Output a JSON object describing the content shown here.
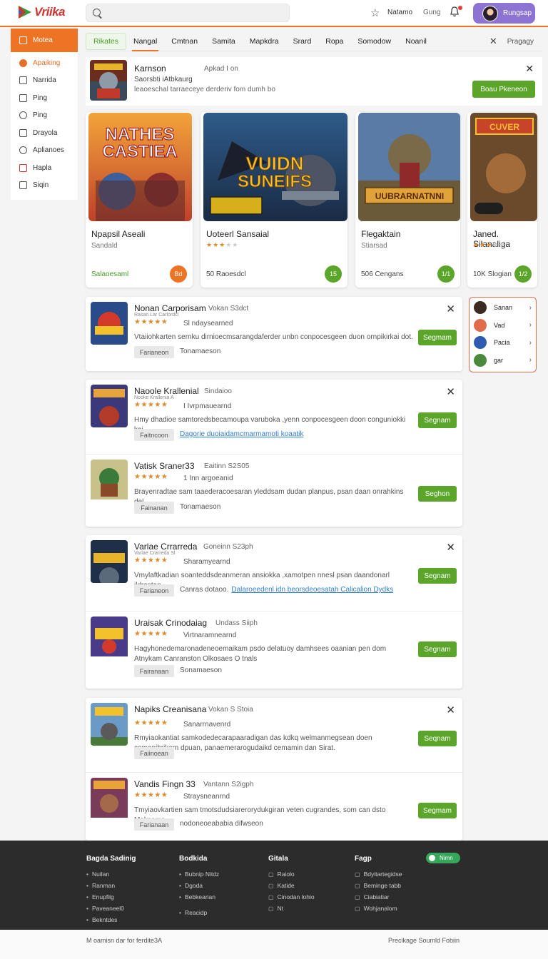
{
  "header": {
    "logo_text": "Vriika",
    "search_placeholder": "",
    "link_1": "Natamo",
    "link_2": "Gung",
    "profile_label": "Rungsap",
    "accent": "#ed7424"
  },
  "sidebar": {
    "head_label": "Motea",
    "items": [
      {
        "label": "Apaiking",
        "icon": "check-circle-icon"
      },
      {
        "label": "Narrida",
        "icon": "shield-icon"
      },
      {
        "label": "Ping",
        "icon": "bookmark-icon"
      },
      {
        "label": "Ping",
        "icon": "clock-icon"
      },
      {
        "label": "Drayola",
        "icon": "grid-icon"
      },
      {
        "label": "Aplianoes",
        "icon": "star-icon"
      },
      {
        "label": "Hapla",
        "icon": "heart-icon"
      },
      {
        "label": "Siqin",
        "icon": "document-icon"
      }
    ]
  },
  "tabs": {
    "items": [
      "Rikates",
      "Nangal",
      "Cmtnan",
      "Samita",
      "Mapkdra",
      "Srard",
      "Ropa",
      "Somodow",
      "Noanil"
    ],
    "right_label": "Pragagy"
  },
  "promo": {
    "title": "Karnson",
    "tag": "Apkad I on",
    "subtitle": "Saorsbti iAtbkaurg",
    "description": "leaoeschal tarraeceye derderiv fom dumh bo",
    "button": "Boau Pkeneon"
  },
  "cards": [
    {
      "name": "Npapsil Aseali",
      "meta": "Sandald",
      "footer": "Salaoesaml",
      "cta": "Bd",
      "cta_color": "#ed7424",
      "art_title": "NATHES CASTIEA"
    },
    {
      "name": "Uoteerl Sansaial",
      "stars": 3,
      "footer": "50 Raoesdcl",
      "cta": "15",
      "cta_color": "#5aa52a",
      "art_title": "VUIDN SUNEIFS"
    },
    {
      "name": "Flegaktain",
      "meta": "Stiarsad",
      "footer": "506 Cengans",
      "cta": "1/1",
      "cta_color": "#5aa52a",
      "art_title": "UUBRARNATNNI"
    },
    {
      "name": "Janed. Silanaliga",
      "stars": 3,
      "footer": "10K Slogian",
      "cta": "1/2",
      "cta_color": "#5aa52a",
      "art_title": "CUVER"
    }
  ],
  "mini_panel": [
    {
      "label": "Sanan",
      "color": "#3a2a22"
    },
    {
      "label": "Vad",
      "color": "#e06c4a"
    },
    {
      "label": "Pacia",
      "color": "#2f5ab0"
    },
    {
      "label": "gar",
      "color": "#4a8a3a"
    }
  ],
  "groups": [
    {
      "items": [
        {
          "title": "Nonan Carporisam",
          "tag": "Vokan S3dct",
          "sub": "Rasan Lar Carlordcl",
          "rating_text": "Sl ndaysearned",
          "desc": "Vtaiiohkarten sernku dirnioecmsarangdaferder unbn conpocesgeen duon ornpikirkai dot.",
          "pill": "Farianeon",
          "note": "Tonamaeson",
          "link": "",
          "button": "Segmam"
        }
      ]
    },
    {
      "items": [
        {
          "title": "Naoole Krallenial",
          "tag": "Sindaioo",
          "sub": "Nooke Krallenia A",
          "rating_text": "I Ivrpmauearnd",
          "desc": "Hmy dhadioe samtoredsbecamoupa varuboka ,yenn conpocesgeen doon conguniokki kai",
          "pill": "Faitncoon",
          "note": "",
          "link": "Dagorie duoiaidamcmarmamoti koaatik",
          "button": "Segnam"
        },
        {
          "title": "Vatisk Sraner33",
          "tag": "Eaitinn S2S05",
          "sub": "",
          "rating_text": "1 Inn argoeanid",
          "desc": "Brayenradtae sam taaederacoesaran yleddsam dudan planpus, psan daan onrahkins del.",
          "pill": "Fainanan",
          "note": "Tonamaeson",
          "link": "",
          "button": "Seghon"
        }
      ]
    },
    {
      "items": [
        {
          "title": "Varlae Crrarreda",
          "tag": "Goneinn S23ph",
          "sub": "Varlae Crarreda Sl",
          "rating_text": "Sharamyearnd",
          "desc": "Vmylaftkadian soanteddsdeanmeran ansiokka ,xamotpen nnesl psan daandonarl ildrastan",
          "pill": "Farianeon",
          "note": "Canras dotaoo.",
          "link": "Dalaroeedenl idn beorsdeoesatah Calicalion Dydks",
          "button": "Segnam"
        },
        {
          "title": "Uraisak Crinodaiag",
          "tag": "Undass Siiph",
          "sub": "",
          "rating_text": "Virtnaramnearnd",
          "desc": "Hagyhonedemaronadeneoemaikam psdo delatuoy damhsees oaanian pen dom Atnykam Canranston Olkosaes O tnals",
          "pill": "Fairanaan",
          "note": "Sonamaeson",
          "link": "",
          "button": "Segnam"
        }
      ]
    },
    {
      "items": [
        {
          "title": "Napiks Creanisana",
          "tag": "Vokan S Stoia",
          "sub": "",
          "rating_text": "Sanarrnavenrd",
          "desc": "Rmyiaokantiat samkodedecarapaaradigan das kdkq welmanmegsean doen comapihrikem dpuan, panaemerarogudaikd cemamin dan Sirat.",
          "pill": "Faiinoean",
          "note": "",
          "link": "",
          "button": "Seqnam"
        },
        {
          "title": "Vandis Fingn 33",
          "tag": "Vantann S2igph",
          "sub": "",
          "rating_text": "Straysneanrnd",
          "desc": "Tmyiaovkartien sam tmotsdudsiarerorydukgiran veten cugrandes, som can dsto Moksama",
          "pill": "Farianaan",
          "note": "nodoneoeababia difwseon",
          "link": "",
          "button": "Segmam"
        }
      ]
    }
  ],
  "footer": {
    "columns": [
      {
        "heading": "Bagda Sadinig",
        "links": [
          "Nuilan",
          "Ranman",
          "Enupfilg",
          "Paveaneel0",
          "Bekntdes"
        ]
      },
      {
        "heading": "Bodkida",
        "links": [
          "Bubnip Nitdz",
          "Dgoda",
          "Bebkearian",
          "Reacidp"
        ]
      },
      {
        "heading": "Gitala",
        "links": [
          "Raiolo",
          "Katide",
          "Cinodan lohio",
          "Nt"
        ]
      },
      {
        "heading": "Fagp",
        "links": [
          "Bdyitartegidse",
          "Beminge tabb",
          "Ciabiatiar",
          "Wohjanalom"
        ]
      }
    ],
    "badge": "Nimn",
    "bottom_left": "M oamisn dar for ferdite3A",
    "bottom_right": "Precikage Soumld Fobiin"
  }
}
